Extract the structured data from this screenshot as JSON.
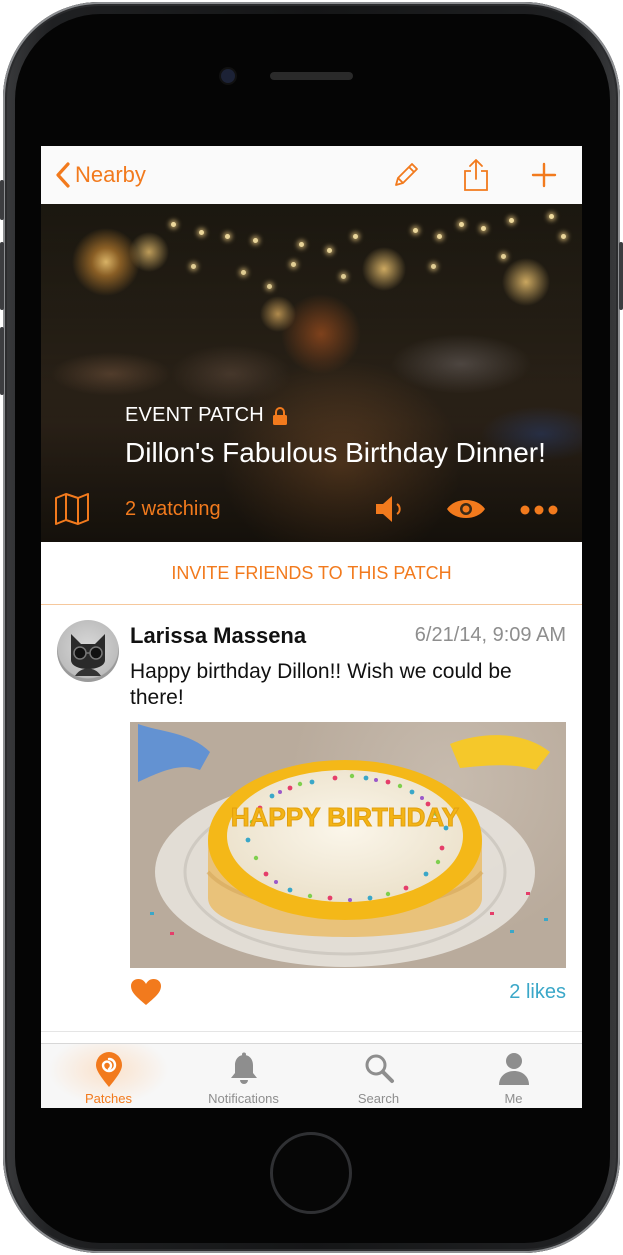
{
  "nav": {
    "back_label": "Nearby",
    "icons": [
      "pencil-icon",
      "share-icon",
      "plus-icon"
    ],
    "accent": "#f27a1d"
  },
  "patch": {
    "type_label": "EVENT PATCH",
    "title": "Dillon's Fabulous Birthday Dinner!",
    "watching": "2 watching",
    "icons": [
      "map-icon",
      "lock-icon",
      "speaker-icon",
      "eye-icon",
      "more-icon"
    ]
  },
  "invite": {
    "label": "INVITE FRIENDS TO THIS PATCH"
  },
  "post": {
    "author": "Larissa Massena",
    "time": "6/21/14, 9:09 AM",
    "text": "Happy birthday Dillon!! Wish we could be there!",
    "image_caption": "HAPPY BIRTHDAY",
    "likes": "2 likes",
    "like_color": "#f27a1d",
    "likes_color": "#3aa7c8"
  },
  "tabbar": {
    "tabs": [
      {
        "label": "Patches",
        "icon": "patch-icon",
        "active": true
      },
      {
        "label": "Notifications",
        "icon": "bell-icon",
        "active": false
      },
      {
        "label": "Search",
        "icon": "search-icon",
        "active": false
      },
      {
        "label": "Me",
        "icon": "person-icon",
        "active": false
      }
    ]
  }
}
